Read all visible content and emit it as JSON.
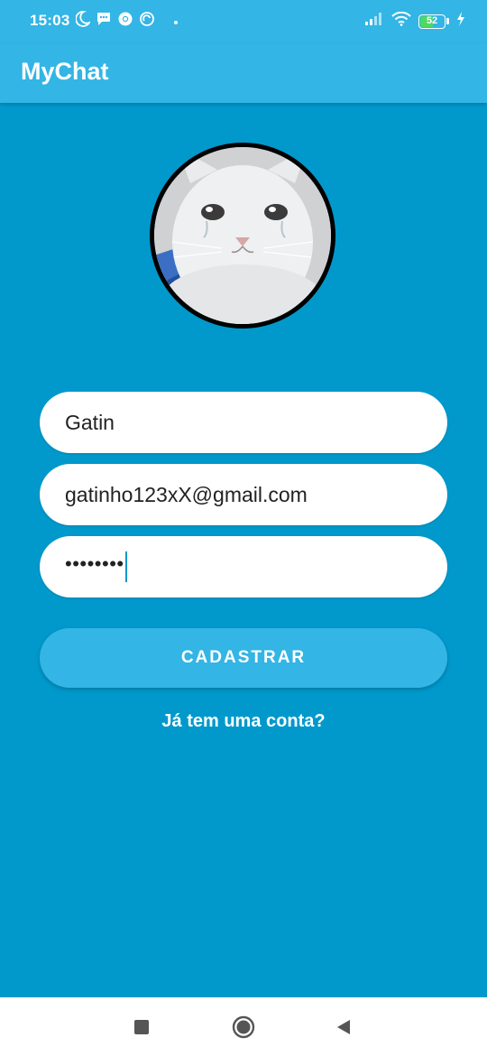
{
  "status_bar": {
    "time": "15:03",
    "left_icons": [
      "moon-icon",
      "message-icon",
      "chrome-icon",
      "sync-icon",
      "dot-icon"
    ],
    "right_icons": [
      "signal-icon",
      "wifi-icon",
      "battery-icon",
      "charging-icon"
    ],
    "battery_level": "52"
  },
  "app_bar": {
    "title": "MyChat"
  },
  "avatar": {
    "icon": "crying-cat-photo"
  },
  "form": {
    "name_value": "Gatin",
    "email_value": "gatinho123xX@gmail.com",
    "password_masked": "••••••••"
  },
  "register_button": {
    "label": "CADASTRAR"
  },
  "login_link": {
    "label": "Já tem uma conta?"
  },
  "colors": {
    "background": "#0199CC",
    "app_bar": "#33B5E5",
    "button": "#33B5E5",
    "battery_fill": "#4cd964"
  },
  "nav_bar": {
    "icons": [
      "recents-icon",
      "home-icon",
      "back-icon"
    ]
  }
}
